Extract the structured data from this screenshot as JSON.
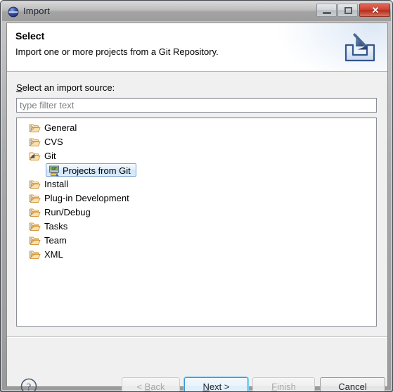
{
  "window": {
    "title": "Import",
    "icon": "eclipse-sphere-icon",
    "controls": {
      "minimize_label": "Minimize",
      "maximize_label": "Maximize",
      "close_label": "✕"
    }
  },
  "banner": {
    "title": "Select",
    "description": "Import one or more projects from a Git Repository.",
    "icon": "import-wizard-icon"
  },
  "content": {
    "source_label_prefix": "S",
    "source_label_rest": "elect an import source:",
    "filter": {
      "value": "",
      "placeholder": "type filter text",
      "icon": "filter-input"
    },
    "tree": [
      {
        "label": "General",
        "level": 0,
        "expanded": false,
        "icon": "folder-icon",
        "selected": false
      },
      {
        "label": "CVS",
        "level": 0,
        "expanded": false,
        "icon": "folder-icon",
        "selected": false
      },
      {
        "label": "Git",
        "level": 0,
        "expanded": true,
        "icon": "folder-icon",
        "selected": false
      },
      {
        "label": "Projects from Git",
        "level": 1,
        "expanded": null,
        "icon": "git-repo-icon",
        "selected": true
      },
      {
        "label": "Install",
        "level": 0,
        "expanded": false,
        "icon": "folder-icon",
        "selected": false
      },
      {
        "label": "Plug-in Development",
        "level": 0,
        "expanded": false,
        "icon": "folder-icon",
        "selected": false
      },
      {
        "label": "Run/Debug",
        "level": 0,
        "expanded": false,
        "icon": "folder-icon",
        "selected": false
      },
      {
        "label": "Tasks",
        "level": 0,
        "expanded": false,
        "icon": "folder-icon",
        "selected": false
      },
      {
        "label": "Team",
        "level": 0,
        "expanded": false,
        "icon": "folder-icon",
        "selected": false
      },
      {
        "label": "XML",
        "level": 0,
        "expanded": false,
        "icon": "folder-icon",
        "selected": false
      }
    ]
  },
  "buttonbar": {
    "help_icon": "help-question-icon",
    "buttons": [
      {
        "id": "back",
        "label": "< Back",
        "mnemonic": "B",
        "state": "disabled",
        "default": false
      },
      {
        "id": "next",
        "label": "Next >",
        "mnemonic": "N",
        "state": "enabled",
        "default": true
      },
      {
        "id": "finish",
        "label": "Finish",
        "mnemonic": "F",
        "state": "disabled",
        "default": false
      },
      {
        "id": "cancel",
        "label": "Cancel",
        "mnemonic": "",
        "state": "enabled",
        "default": false
      }
    ],
    "back_pre": "< ",
    "back_mn": "B",
    "back_post": "ack",
    "next_pre": "",
    "next_mn": "N",
    "next_post": "ext >",
    "finish_pre": "",
    "finish_mn": "F",
    "finish_post": "inish",
    "cancel_text": "Cancel"
  },
  "colors": {
    "accent_blue": "#3c96d4",
    "focus_glow": "#79d0f7",
    "selection_border": "#7da2ce",
    "folder": "#e8a33d",
    "close_red": "#cf4231",
    "dialog_bg": "#f0f0f0",
    "field_bg": "#ffffff"
  }
}
